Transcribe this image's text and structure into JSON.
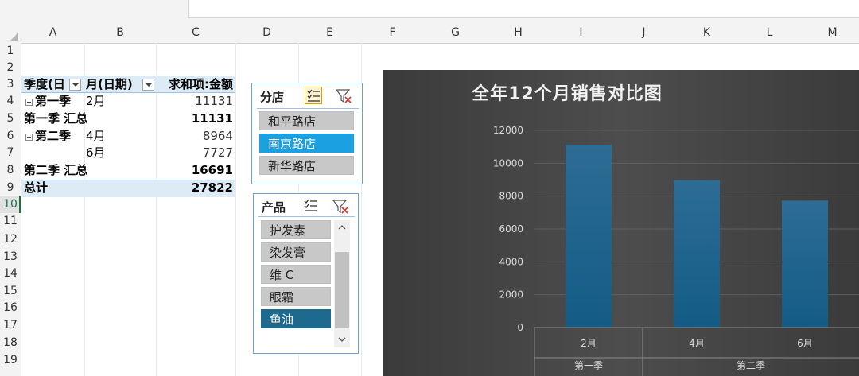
{
  "columns": [
    "A",
    "B",
    "C",
    "D",
    "E",
    "F",
    "G",
    "H",
    "I",
    "J",
    "K",
    "L",
    "M"
  ],
  "rows": [
    "1",
    "2",
    "3",
    "4",
    "5",
    "6",
    "7",
    "8",
    "9",
    "10",
    "11",
    "12",
    "13",
    "14",
    "15",
    "16",
    "17",
    "18",
    "19"
  ],
  "pivot": {
    "header": {
      "col_a": "季度(日",
      "col_b": "月(日期)",
      "col_c": "求和项:金额"
    },
    "rows": [
      {
        "a": "第一季",
        "b": "2月",
        "c": "11131"
      },
      {
        "a": "第一季 汇总",
        "b": "",
        "c": "11131"
      },
      {
        "a": "第二季",
        "b": "4月",
        "c": "8964"
      },
      {
        "a": "",
        "b": "6月",
        "c": "7727"
      },
      {
        "a": "第二季 汇总",
        "b": "",
        "c": "16691"
      },
      {
        "a": "总计",
        "b": "",
        "c": "27822"
      }
    ]
  },
  "slicer_store": {
    "title": "分店",
    "items": [
      "和平路店",
      "南京路店",
      "新华路店"
    ],
    "selected": "南京路店"
  },
  "slicer_product": {
    "title": "产品",
    "items": [
      "护发素",
      "染发膏",
      "维 C",
      "眼霜",
      "鱼油"
    ],
    "selected": "鱼油"
  },
  "chart_data": {
    "type": "bar",
    "title": "全年12个月销售对比图",
    "categories": [
      "2月",
      "4月",
      "6月"
    ],
    "groups": [
      {
        "label": "第一季",
        "categories": [
          "2月"
        ]
      },
      {
        "label": "第二季",
        "categories": [
          "4月",
          "6月"
        ]
      }
    ],
    "values": [
      11131,
      8964,
      7727
    ],
    "yticks": [
      "0",
      "2000",
      "4000",
      "6000",
      "8000",
      "10000",
      "12000"
    ],
    "ylim": [
      0,
      12000
    ],
    "grid": true,
    "bar_color_top": "#2d6c95",
    "bar_color_bottom": "#135c86",
    "background": "#404040"
  }
}
